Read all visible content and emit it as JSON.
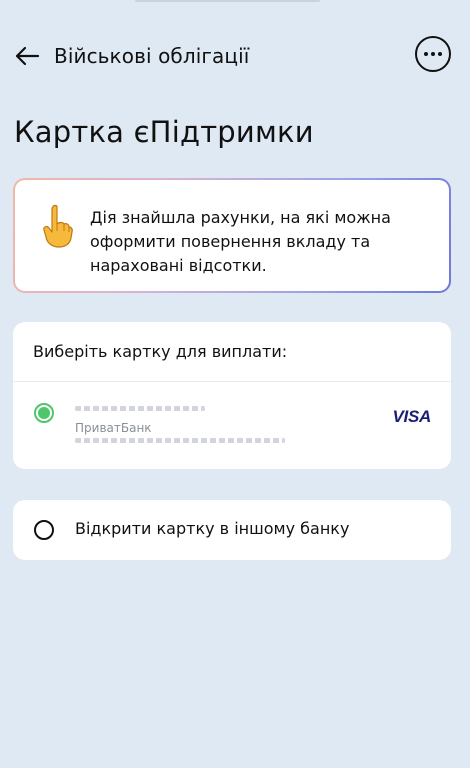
{
  "header": {
    "title": "Військові облігації",
    "back_icon": "arrow-left-icon",
    "more_icon": "more-horizontal-icon"
  },
  "page": {
    "title": "Картка єПідтримки"
  },
  "notice": {
    "icon": "pointing-up-hand-icon",
    "text": "Дія знайшла рахунки, на які можна оформити повернення вкладу та нараховані відсотки."
  },
  "card_select": {
    "header": "Виберіть картку для виплати:",
    "cards": [
      {
        "bank": "ПриватБанк",
        "brand": "VISA",
        "selected": true
      }
    ]
  },
  "other_option": {
    "label": "Відкрити картку в іншому банку",
    "selected": false
  },
  "colors": {
    "background": "#dfe9f3",
    "radio_selected": "#4dc76a",
    "visa": "#1a1f71"
  }
}
